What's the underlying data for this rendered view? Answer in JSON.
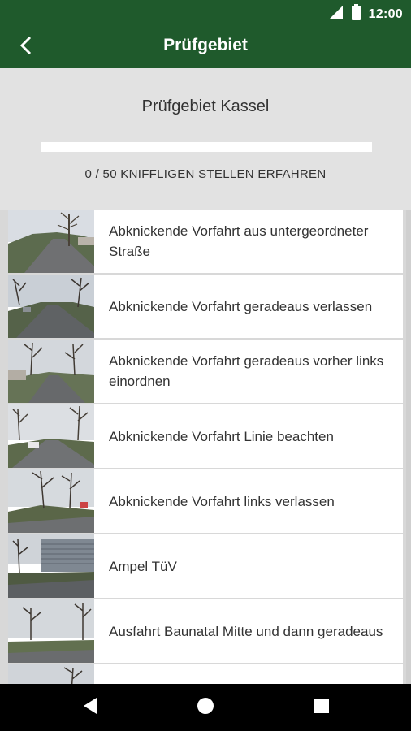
{
  "status_bar": {
    "time": "12:00"
  },
  "appbar": {
    "title": "Prüfgebiet",
    "back_icon": "chevron-left-icon"
  },
  "header": {
    "region_title": "Prüfgebiet Kassel",
    "progress_label": "0 / 50 KNIFFLIGEN STELLEN ERFAHREN",
    "progress_fraction": 0
  },
  "list": {
    "items": [
      {
        "label": "Abknickende Vorfahrt aus untergeordneter Straße"
      },
      {
        "label": "Abknickende Vorfahrt geradeaus verlassen"
      },
      {
        "label": "Abknickende Vorfahrt geradeaus vorher links einordnen"
      },
      {
        "label": "Abknickende Vorfahrt Linie beachten"
      },
      {
        "label": "Abknickende Vorfahrt links verlassen"
      },
      {
        "label": "Ampel TüV"
      },
      {
        "label": "Ausfahrt Baunatal Mitte und dann geradeaus"
      },
      {
        "label": ""
      }
    ]
  },
  "colors": {
    "primary": "#1f5a2c",
    "background": "#e2e2e2"
  }
}
